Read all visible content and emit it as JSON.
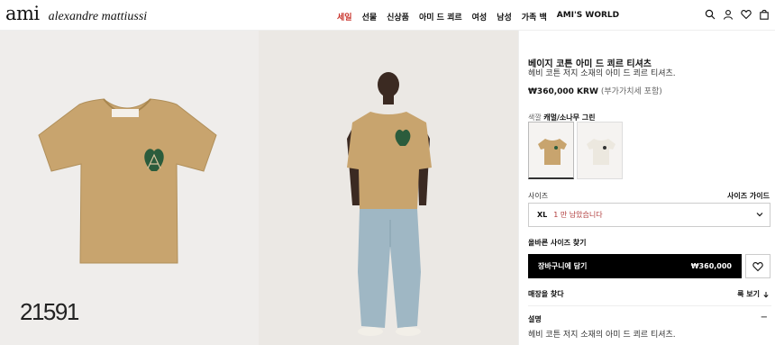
{
  "brand": {
    "logo": "ami",
    "name": "alexandre mattiussi"
  },
  "nav": {
    "items": [
      "세일",
      "선물",
      "신상품",
      "아미 드 쾨르",
      "여성",
      "남성",
      "가족 백",
      "AMI'S WORLD"
    ]
  },
  "header_icons": [
    "search-icon",
    "account-icon",
    "heart-icon",
    "bag-icon"
  ],
  "colors": {
    "sale": "#c8332b",
    "product_tan": "#c8a46e",
    "heart_green": "#2b5c3c",
    "jeans": "#9fb7c4",
    "stock_red": "#b03a3a"
  },
  "watermark": "21591",
  "product": {
    "title": "베이지 코튼 아미 드 쾨르 티셔츠",
    "subtitle": "헤비 코튼 저지 소재의 아미 드 쾨르 티셔츠.",
    "price": "₩360,000 KRW",
    "vat_note": "(부가가치세 포함)",
    "color_label": "색깔",
    "color_value": "캐멀/소나무 그린",
    "size_label": "사이즈",
    "size_guide": "사이즈 가이드",
    "selected_size": "XL",
    "stock_note": "1 만 남았습니다",
    "fit_link": "올바른 사이즈 찾기",
    "cart_label": "장바구니에 담기",
    "cart_price": "₩360,000",
    "store_label": "매장을 찾다",
    "view_label": "룩 보기",
    "desc_label": "설명",
    "desc_text": "헤비 코튼 저지 소재의 아미 드 쾨르 티셔츠."
  }
}
